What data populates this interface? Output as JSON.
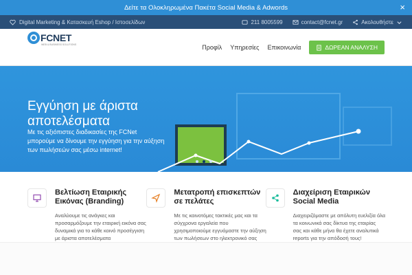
{
  "promo": {
    "text": "Δείτε τα Ολοκληρωμένα Πακέτα Social Media & Adwords",
    "close": "×"
  },
  "topbar": {
    "tagline": "Digital Marketing & Κατασκευή Eshop / Ιστοσελίδων",
    "phone": "211 8005599",
    "email": "contact@fcnet.gr",
    "follow": "Ακολουθήστε"
  },
  "header": {
    "logo_text": "FCNET",
    "logo_sub": "WEB & BUSINESS SOLUTIONS",
    "nav": [
      "Προφίλ",
      "Υπηρεσίες",
      "Επικοινωνία"
    ],
    "cta": "ΔΩΡΕΑΝ ΑΝΑΛΥΣΗ"
  },
  "hero": {
    "title": "Εγγύηση με άριστα αποτελέσματα",
    "text": "Με τις αξιόπιστες διαδικασίες της FCNet μπορούμε να δίνουμε την εγγύηση για την αύξηση των πωλήσεών σας μέσω internet!"
  },
  "features": [
    {
      "icon": "monitor-icon",
      "title": "Βελτίωση Εταιρικής Εικόνας (Branding)",
      "text": "Αναλύουμε τις ανάγκες και προσαρμόζουμε την εταιρική εικόνα σας δυναμικά για το κάθε κοινό προσέγγιση με άριστα αποτελέσματα"
    },
    {
      "icon": "send-icon",
      "title": "Μετατροπή επισκεπτών σε πελάτες",
      "text": "Με τις καινοτόμες τακτικές μας και τα σύγχρονα εργαλεία που χρησιμοποιούμε εγγυόμαστε την αύξηση των πωλήσεων στο ηλεκτρονικό σας κατάστημα."
    },
    {
      "icon": "share-icon",
      "title": "Διαχείριση Εταιρικών Social Media",
      "text": "Διαχειριζόμαστε με απόλυτη ευελιξία όλα τα κοινωνικά σας δίκτυα της εταιρίας σας και κάθε μήνα θα έχετε αναλυτικά reports για την απόδοσή τους!"
    }
  ],
  "colors": {
    "primary": "#2f8fd6",
    "topbar": "#2a4f78",
    "cta": "#6cc24a",
    "screen": "#7cc13f"
  }
}
